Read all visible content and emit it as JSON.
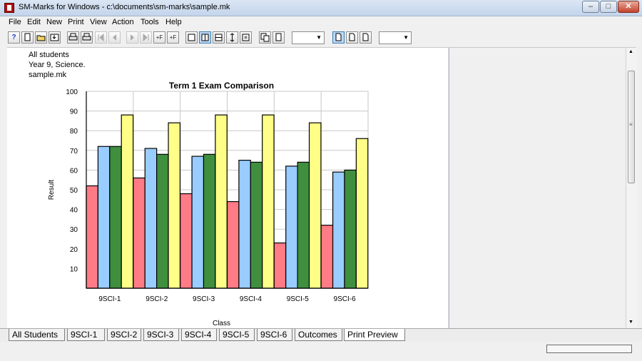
{
  "window": {
    "title": "SM-Marks for Windows - c:\\documents\\sm-marks\\sample.mk",
    "minimize": "–",
    "maximize": "□",
    "close": "✕"
  },
  "menu": [
    "File",
    "Edit",
    "New",
    "Print",
    "View",
    "Action",
    "Tools",
    "Help"
  ],
  "toolbar": {
    "help": "?",
    "first_filter": "+F",
    "last_filter": "+F"
  },
  "document": {
    "lines": [
      "All students",
      "Year 9, Science.",
      "sample.mk"
    ]
  },
  "chart_data": {
    "type": "bar",
    "title": "Term 1 Exam Comparison",
    "xlabel": "Class",
    "ylabel": "Result",
    "ylim": [
      0,
      100
    ],
    "yticks": [
      10,
      20,
      30,
      40,
      50,
      60,
      70,
      80,
      90,
      100
    ],
    "grid": true,
    "categories": [
      "9SCI-1",
      "9SCI-2",
      "9SCI-3",
      "9SCI-4",
      "9SCI-5",
      "9SCI-6"
    ],
    "series": [
      {
        "values": [
          52,
          56,
          48,
          44,
          23,
          32
        ],
        "color": "#ff7b85"
      },
      {
        "values": [
          72,
          71,
          67,
          65,
          62,
          59
        ],
        "color": "#99ccff"
      },
      {
        "values": [
          72,
          68,
          68,
          64,
          64,
          60
        ],
        "color": "#3f8f3f"
      },
      {
        "values": [
          88,
          84,
          88,
          88,
          84,
          76
        ],
        "color": "#ffff88"
      }
    ]
  },
  "tabs": [
    "All Students",
    "9SCI-1",
    "9SCI-2",
    "9SCI-3",
    "9SCI-4",
    "9SCI-5",
    "9SCI-6",
    "Outcomes",
    "Print Preview"
  ],
  "selected_tab": "Print Preview",
  "scroll": {
    "up": "▲",
    "down": "▼",
    "grip": "≡"
  }
}
